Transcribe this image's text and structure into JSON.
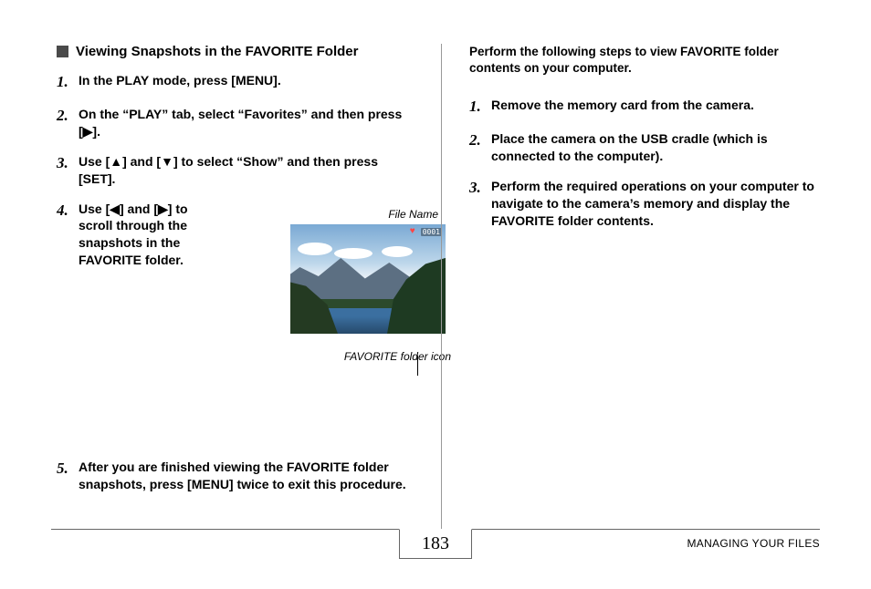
{
  "left": {
    "heading": "Viewing Snapshots in the FAVORITE Folder",
    "steps": {
      "s1": "In the PLAY mode, press [MENU].",
      "s2": "On the “PLAY” tab, select “Favorites” and then press [▶].",
      "s3": "Use [▲] and [▼] to select “Show” and then press [SET].",
      "s4": "Use [◀] and [▶] to scroll through the snapshots in the FAVORITE folder.",
      "s5": "After you are finished viewing the FAVORITE folder snapshots, press [MENU] twice to exit this procedure."
    },
    "fig_top_label": "File Name",
    "fig_bottom_label": "FAVORITE folder icon",
    "fig_file_num": "0001"
  },
  "right": {
    "intro": "Perform the following steps to view FAVORITE folder contents on your computer.",
    "steps": {
      "s1": "Remove the memory card from the camera.",
      "s2": "Place the camera on the USB cradle (which is connected to the computer).",
      "s3": "Perform the required operations on your computer to navigate to the camera’s memory and display the FAVORITE folder contents."
    }
  },
  "footer": {
    "page": "183",
    "section": "MANAGING YOUR FILES"
  }
}
